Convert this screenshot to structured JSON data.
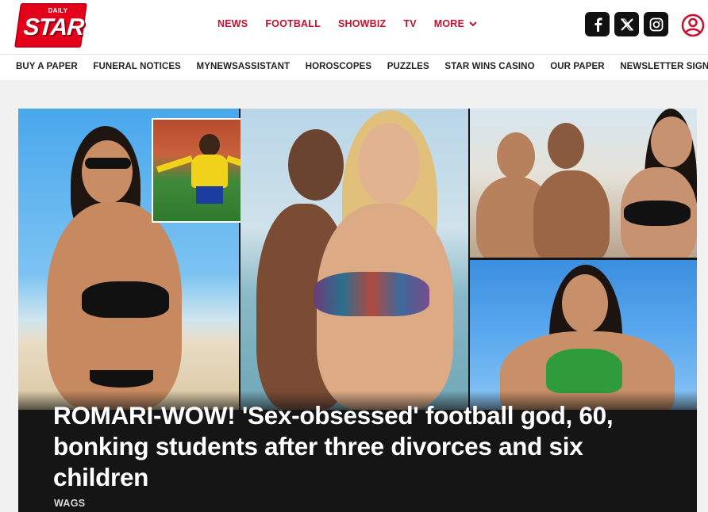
{
  "brand": {
    "logo_top": "DAILY",
    "logo_main": "STAR",
    "accent": "#e4001b"
  },
  "main_nav": [
    {
      "label": "NEWS"
    },
    {
      "label": "FOOTBALL"
    },
    {
      "label": "SHOWBIZ"
    },
    {
      "label": "TV"
    },
    {
      "label": "MORE",
      "icon": "chevron-down-icon"
    }
  ],
  "social": [
    {
      "name": "facebook-icon",
      "glyph": "f"
    },
    {
      "name": "x-icon",
      "glyph": "𝕏"
    },
    {
      "name": "instagram-icon",
      "glyph": ""
    }
  ],
  "account_icon": "user-account-icon",
  "secondary_nav": [
    "BUY A PAPER",
    "FUNERAL NOTICES",
    "MYNEWSASSISTANT",
    "HOROSCOPES",
    "PUZZLES",
    "STAR WINS CASINO",
    "OUR PAPER",
    "NEWSLETTER SIGNUP"
  ],
  "hero": {
    "headline": "ROMARI-WOW! 'Sex-obsessed' football god, 60, bonking students after three divorces and six children",
    "tag": "WAGS"
  }
}
